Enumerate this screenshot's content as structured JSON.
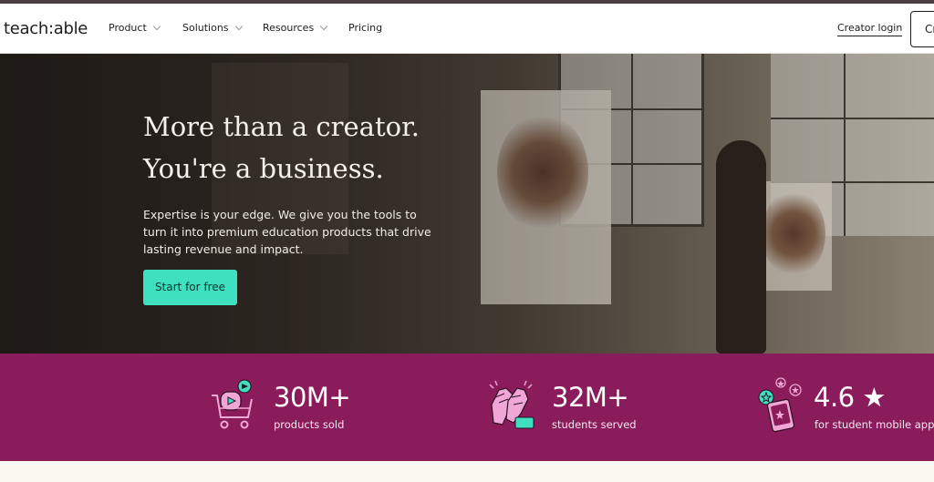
{
  "nav": {
    "logo": "teach:able",
    "items": [
      {
        "label": "Product"
      },
      {
        "label": "Solutions"
      },
      {
        "label": "Resources"
      },
      {
        "label": "Pricing"
      }
    ],
    "creator_login": "Creator login",
    "cta_partial": "Cr"
  },
  "hero": {
    "title_line1": "More than a creator.",
    "title_line2": "You're a business.",
    "subtitle": "Expertise is your edge. We give you the tools to turn it into premium education products that drive lasting revenue and impact.",
    "cta": "Start for free"
  },
  "stats": [
    {
      "value": "30M+",
      "label": "products sold",
      "icon": "shopping-cart-icon"
    },
    {
      "value": "32M+",
      "label": "students served",
      "icon": "high-five-hands-icon"
    },
    {
      "value": "4.6 ★",
      "label": "for student mobile app",
      "icon": "mobile-rating-icon"
    }
  ],
  "colors": {
    "stats_band": "#8b1c5c",
    "cta": "#3ee0bf",
    "icon_accent": "#f0a6d6",
    "icon_green": "#3ee0bf"
  }
}
